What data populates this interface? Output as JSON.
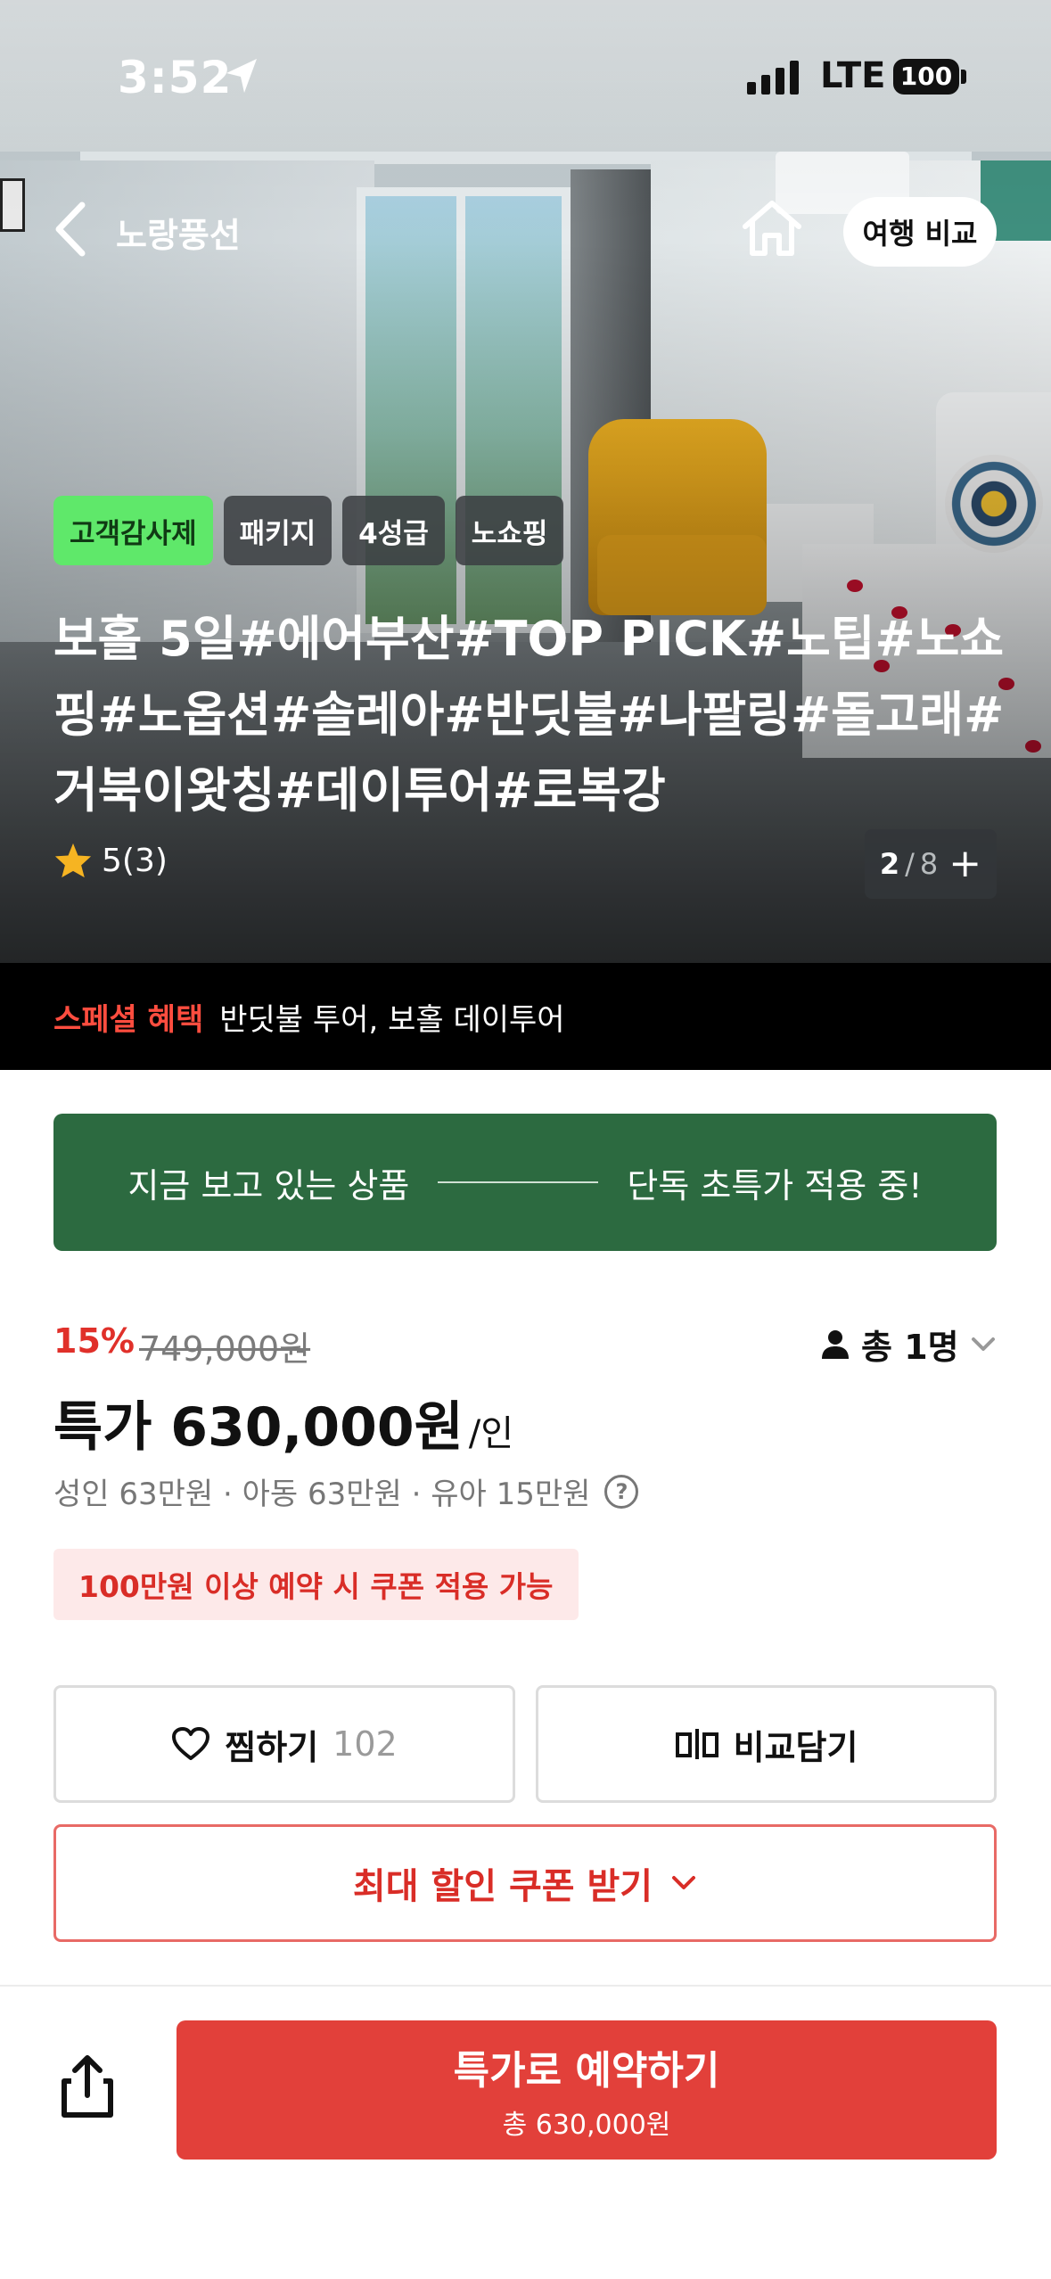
{
  "status_bar": {
    "time": "3:52",
    "network": "LTE",
    "battery": "100"
  },
  "nav": {
    "title": "노랑풍선",
    "compare_label": "여행 비교"
  },
  "hero": {
    "tags": [
      "고객감사제",
      "패키지",
      "4성급",
      "노쇼핑"
    ],
    "title": "보홀 5일#에어부산#TOP PICK#노팁#노쇼핑#노옵션#솔레아#반딧불#나팔링#돌고래#거북이왓칭#데이투어#로복강",
    "rating": "5(3)",
    "photo_counter": {
      "current": "2",
      "separator": "/",
      "total": "8",
      "plus": "+"
    }
  },
  "benefit": {
    "label": "스페셜 혜택",
    "text": "반딧불 투어, 보홀 데이투어"
  },
  "banner": {
    "left": "지금 보고 있는 상품",
    "right": "단독 초특가 적용 중!"
  },
  "price": {
    "discount": "15%",
    "original": "749,000원",
    "pax_label": "총 1명",
    "sale": "특가 630,000원",
    "unit": "/인",
    "breakdown": "성인 63만원 · 아동 63만원 · 유아 15만원",
    "coupon_note": "100만원 이상 예약 시 쿠폰 적용 가능"
  },
  "actions": {
    "wish_label": "찜하기",
    "wish_count": "102",
    "compare_label": "비교담기",
    "coupon_label": "최대 할인 쿠폰 받기"
  },
  "bottom": {
    "reserve_label": "특가로 예약하기",
    "reserve_total": "총 630,000원"
  },
  "colors": {
    "accent_red": "#e2403a",
    "banner_green": "#2c6a40",
    "tag_green": "#5fe86a"
  },
  "icons": [
    "back-arrow-icon",
    "home-icon",
    "star-icon",
    "person-icon",
    "chevron-down-icon",
    "help-icon",
    "heart-icon",
    "compare-icon",
    "share-icon",
    "location-arrow-icon"
  ]
}
